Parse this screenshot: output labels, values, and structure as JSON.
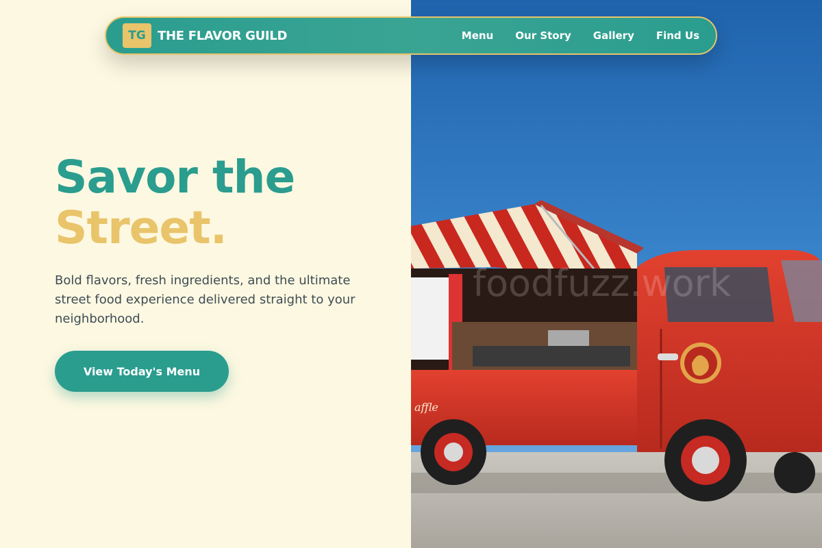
{
  "brand": {
    "logo_text": "TG",
    "name": "THE FLAVOR GUILD"
  },
  "nav": {
    "links": [
      "Menu",
      "Our Story",
      "Gallery",
      "Find Us"
    ]
  },
  "hero": {
    "title_line1": "Savor the",
    "title_line2": "Street.",
    "description": "Bold flavors, fresh ingredients, and the ultimate street food experience delivered straight to your neighborhood.",
    "cta_label": "View Today's Menu"
  },
  "image": {
    "watermark": "foodfuzz.work",
    "truck_text": "affle"
  },
  "colors": {
    "background": "#fdf8e1",
    "primary_teal": "#2a9d8f",
    "accent_gold": "#e9c46a",
    "body_text": "#3e4c55"
  }
}
